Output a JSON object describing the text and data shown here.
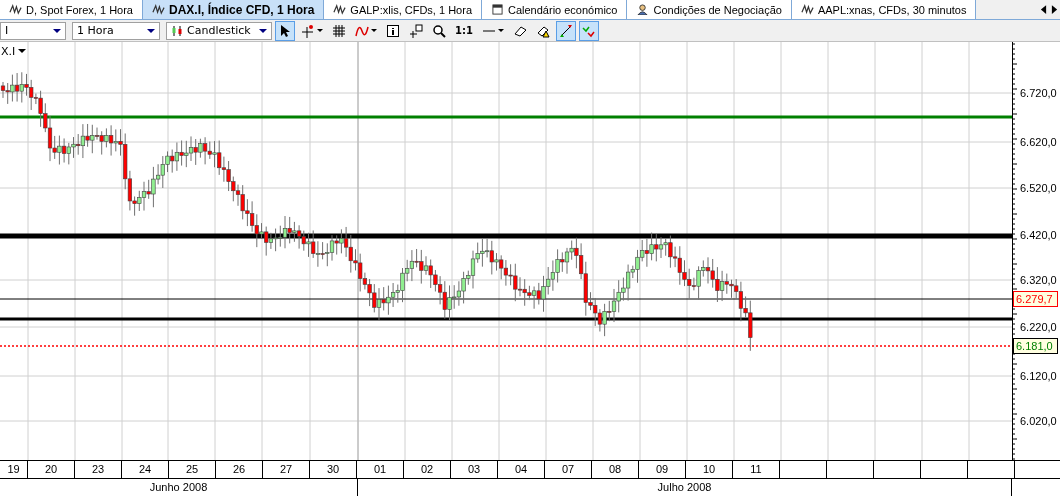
{
  "tabs": [
    {
      "label": "D, Spot Forex, 1 Hora",
      "kind": "chart",
      "selected": false
    },
    {
      "label": "DAX.I, Índice CFD, 1 Hora",
      "kind": "chart",
      "selected": true
    },
    {
      "label": "GALP:xlis, CFDs, 1 Hora",
      "kind": "chart",
      "selected": false
    },
    {
      "label": "Calendário económico",
      "kind": "calendar",
      "selected": false
    },
    {
      "label": "Condições de Negociação",
      "kind": "person",
      "selected": false
    },
    {
      "label": "AAPL:xnas, CFDs, 30 minutos",
      "kind": "chart",
      "selected": false
    }
  ],
  "toolbar": {
    "symbol_select": {
      "value": "I"
    },
    "interval_select": {
      "value": "1 Hora"
    },
    "chart_type_select": {
      "value": "Candlestick"
    },
    "tools": [
      {
        "kind": "pointer",
        "selected": true
      },
      {
        "kind": "crosshair",
        "selected": false
      },
      {
        "kind": "grid",
        "selected": false
      },
      {
        "kind": "indicator",
        "selected": false
      },
      {
        "kind": "info",
        "selected": false
      },
      {
        "kind": "note",
        "selected": false
      },
      {
        "kind": "zoom",
        "selected": false
      },
      {
        "kind": "text",
        "label": "1:1",
        "selected": false
      },
      {
        "kind": "line",
        "selected": false
      },
      {
        "kind": "eraser",
        "selected": false
      },
      {
        "kind": "alert",
        "selected": false
      },
      {
        "kind": "trend",
        "selected": true
      },
      {
        "kind": "scatter",
        "selected": true
      }
    ]
  },
  "chart": {
    "title": "X.I",
    "y_ticks": [
      "6.720,0",
      "6.620,0",
      "6.520,0",
      "6.420,0",
      "6.320,0",
      "6.220,0",
      "6.120,0",
      "6.020,0"
    ],
    "price_tags": [
      {
        "text": "6.279,7",
        "color": "#ff0000"
      },
      {
        "text": "6.181,0",
        "color": "#008000"
      }
    ],
    "days": [
      "19",
      "20",
      "23",
      "24",
      "25",
      "26",
      "27",
      "30",
      "01",
      "02",
      "03",
      "04",
      "07",
      "08",
      "09",
      "10",
      "11"
    ],
    "months": [
      "Junho 2008",
      "Julho 2008"
    ]
  }
}
